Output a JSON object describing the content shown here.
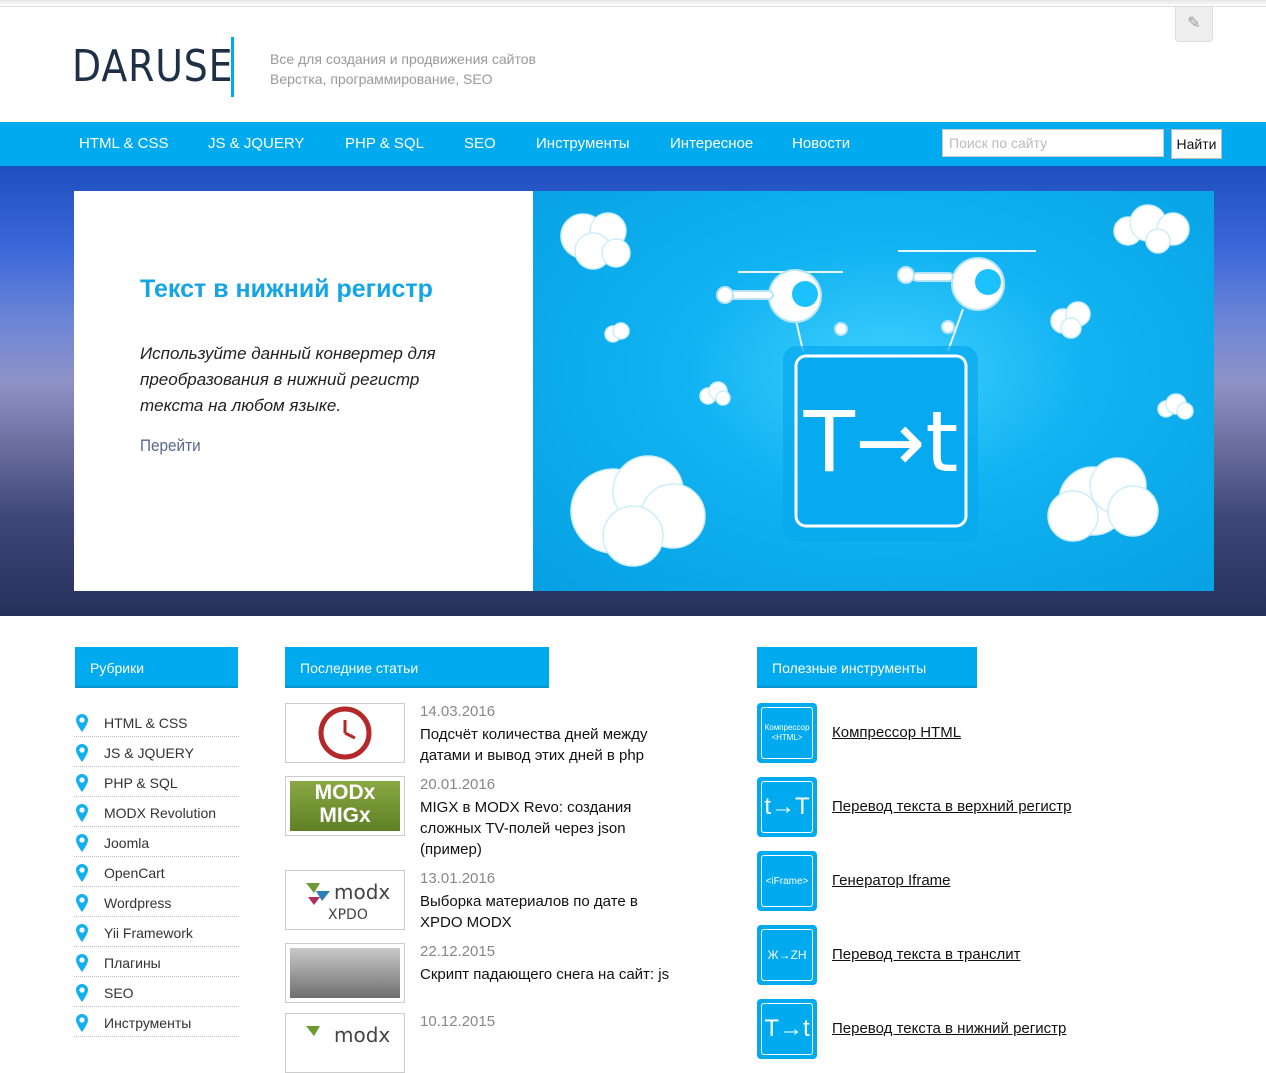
{
  "header": {
    "logo": "DARUSE",
    "tagline_1": "Все для создания и продвижения сайтов",
    "tagline_2": "Верстка, программирование, SEO"
  },
  "nav": {
    "items": [
      "HTML & CSS",
      "JS & JQUERY",
      "PHP & SQL",
      "SEO",
      "Инструменты",
      "Интересное",
      "Новости"
    ],
    "search_placeholder": "Поиск по сайту",
    "search_button": "Найти"
  },
  "slide": {
    "title": "Текст в нижний регистр",
    "text": "Используйте данный конвертер для преобразования в нижний регистр текста на любом языке.",
    "link": "Перейти",
    "badge_text": "T→t"
  },
  "sidebar": {
    "title": "Рубрики",
    "items": [
      "HTML & CSS",
      "JS & JQUERY",
      "PHP & SQL",
      "MODX Revolution",
      "Joomla",
      "OpenCart",
      "Wordpress",
      "Yii Framework",
      "Плагины",
      "SEO",
      "Инструменты"
    ]
  },
  "articles": {
    "title": "Последние статьи",
    "items": [
      {
        "date": "14.03.2016",
        "title": "Подсчёт количества дней между датами и вывод этих дней в php",
        "thumb": "clock-icon"
      },
      {
        "date": "20.01.2016",
        "title": "MIGX в MODX Revo: создания сложных TV-полей через json (пример)",
        "thumb": "MODx MIGx"
      },
      {
        "date": "13.01.2016",
        "title": "Выборка материалов по дате в XPDO MODX",
        "thumb": "modx XPDO"
      },
      {
        "date": "22.12.2015",
        "title": "Скрипт падающего снега на сайт: js",
        "thumb": "snow-image"
      },
      {
        "date": "10.12.2015",
        "title": "",
        "thumb": "modx"
      }
    ]
  },
  "tools": {
    "title": "Полезные инструменты",
    "items": [
      {
        "icon_text": "Компрессор <HTML>",
        "name": "Компрессор HTML"
      },
      {
        "icon_text": "t→T",
        "name": "Перевод текста в верхний регистр"
      },
      {
        "icon_text": "<iFrame>",
        "name": "Генератор Iframe"
      },
      {
        "icon_text": "Ж→ZH",
        "name": "Перевод текста в транслит"
      },
      {
        "icon_text": "T→t",
        "name": "Перевод текста в нижний регистр"
      }
    ]
  },
  "colors": {
    "accent": "#00aaef",
    "logo": "#1e3046",
    "slide_title": "#14a5e6"
  }
}
